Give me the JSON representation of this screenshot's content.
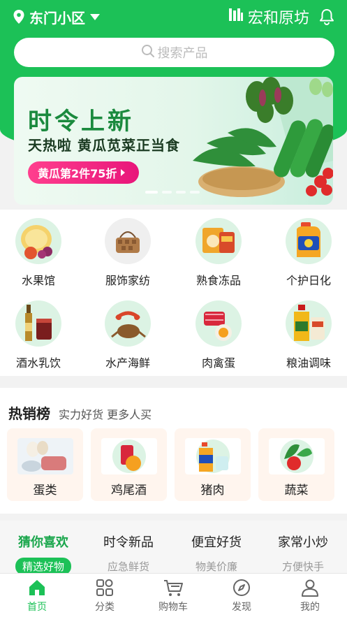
{
  "header": {
    "location": "东门小区",
    "brand": "宏和原坊"
  },
  "search": {
    "placeholder": "搜索产品"
  },
  "banner": {
    "title": "时令上新",
    "subtitle": "天热啦 黄瓜苋菜正当食",
    "promo": "黄瓜第2件75折",
    "slide_count": 4,
    "active_slide": 1
  },
  "categories": [
    {
      "label": "水果馆",
      "icon": "fruit-icon"
    },
    {
      "label": "服饰家纺",
      "icon": "handbag-icon"
    },
    {
      "label": "熟食冻品",
      "icon": "snack-pack-icon"
    },
    {
      "label": "个护日化",
      "icon": "detergent-icon"
    },
    {
      "label": "酒水乳饮",
      "icon": "beverage-icon"
    },
    {
      "label": "水产海鲜",
      "icon": "seafood-icon"
    },
    {
      "label": "肉禽蛋",
      "icon": "meat-egg-icon"
    },
    {
      "label": "粮油调味",
      "icon": "cooking-oil-icon"
    }
  ],
  "hot": {
    "title": "热销榜",
    "subtitle": "实力好货 更多人买",
    "items": [
      {
        "name": "蛋类",
        "icon": "eggs-meat-icon"
      },
      {
        "name": "鸡尾酒",
        "icon": "cocktail-icon"
      },
      {
        "name": "猪肉",
        "icon": "detergent-icon"
      },
      {
        "name": "蔬菜",
        "icon": "vegetable-icon"
      }
    ]
  },
  "feed_tabs": [
    {
      "label": "猜你喜欢",
      "sub": "精选好物",
      "active": true
    },
    {
      "label": "时令新品",
      "sub": "应急鲜货",
      "active": false
    },
    {
      "label": "便宜好货",
      "sub": "物美价廉",
      "active": false
    },
    {
      "label": "家常小炒",
      "sub": "方便快手",
      "active": false
    }
  ],
  "nav": [
    {
      "label": "首页",
      "icon": "home-icon",
      "active": true
    },
    {
      "label": "分类",
      "icon": "grid-icon",
      "active": false
    },
    {
      "label": "购物车",
      "icon": "cart-icon",
      "active": false
    },
    {
      "label": "发现",
      "icon": "compass-icon",
      "active": false
    },
    {
      "label": "我的",
      "icon": "user-icon",
      "active": false
    }
  ],
  "colors": {
    "brand_green": "#1cc157",
    "active_tab_text": "#1aa64c",
    "promo_pink": "#e8157a",
    "hot_card_bg": "#fff5ee"
  }
}
